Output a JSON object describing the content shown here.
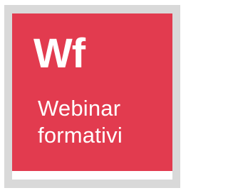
{
  "logo": {
    "abbreviation": "Wf",
    "line1": "Webinar",
    "line2": "formativi"
  },
  "colors": {
    "tile": "#e23b4f",
    "frame": "#d9d9d9",
    "text": "#ffffff",
    "band": "#ffffff"
  }
}
